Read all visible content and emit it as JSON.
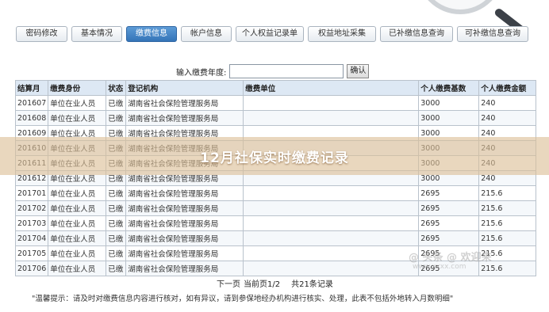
{
  "tabs": [
    {
      "label": "密码修改",
      "active": false
    },
    {
      "label": "基本情况",
      "active": false
    },
    {
      "label": "缴费信息",
      "active": true
    },
    {
      "label": "帐户信息",
      "active": false
    },
    {
      "label": "个人权益记录单",
      "active": false
    },
    {
      "label": "权益地址采集",
      "active": false
    },
    {
      "label": "已补缴信息查询",
      "active": false
    },
    {
      "label": "可补缴信息查询",
      "active": false
    }
  ],
  "year_filter": {
    "label": "输入缴费年度:",
    "value": "",
    "button_label": "确认"
  },
  "table": {
    "headers": [
      "结算月",
      "缴费身份",
      "状态",
      "登记机构",
      "缴费单位",
      "个人缴费基数",
      "个人缴费金额"
    ],
    "rows": [
      [
        "201607",
        "单位在业人员",
        "已缴",
        "湖南省社会保险管理服务局",
        "",
        "3000",
        "240"
      ],
      [
        "201608",
        "单位在业人员",
        "已缴",
        "湖南省社会保险管理服务局",
        "",
        "3000",
        "240"
      ],
      [
        "201609",
        "单位在业人员",
        "已缴",
        "湖南省社会保险管理服务局",
        "",
        "3000",
        "240"
      ],
      [
        "201610",
        "单位在业人员",
        "已缴",
        "湖南省社会保险管理服务局",
        "",
        "3000",
        "240"
      ],
      [
        "201611",
        "单位在业人员",
        "已缴",
        "湖南省社会保险管理服务局",
        "",
        "3000",
        "240"
      ],
      [
        "201612",
        "单位在业人员",
        "已缴",
        "湖南省社会保险管理服务局",
        "",
        "3000",
        "240"
      ],
      [
        "201701",
        "单位在业人员",
        "已缴",
        "湖南省社会保险管理服务局",
        "",
        "2695",
        "215.6"
      ],
      [
        "201702",
        "单位在业人员",
        "已缴",
        "湖南省社会保险管理服务局",
        "",
        "2695",
        "215.6"
      ],
      [
        "201703",
        "单位在业人员",
        "已缴",
        "湖南省社会保险管理服务局",
        "",
        "2695",
        "215.6"
      ],
      [
        "201704",
        "单位在业人员",
        "已缴",
        "湖南省社会保险管理服务局",
        "",
        "2695",
        "215.6"
      ],
      [
        "201705",
        "单位在业人员",
        "已缴",
        "湖南省社会保险管理服务局",
        "",
        "2695",
        "215.6"
      ],
      [
        "201706",
        "单位在业人员",
        "已缴",
        "湖南省社会保险管理服务局",
        "",
        "2695",
        "215.6"
      ]
    ]
  },
  "pager": {
    "next_label": "下一页",
    "page_info": "当前页1/2",
    "total": "共21条记录"
  },
  "tip": "\"温馨提示：请及时对缴费信息内容进行核对，如有异议，请到参保地经办机构进行核实、处理，此表不包括外地转入月数明细\"",
  "overlay_title": "12月社保实时缴费记录",
  "watermark": "@ 头条 @ 欢迎来",
  "watermark_url": "www.xxxx.com",
  "colors": {
    "active_tab": "#3474b8",
    "header_bg": "#dde8f4",
    "overlay": "#dcbe96"
  }
}
